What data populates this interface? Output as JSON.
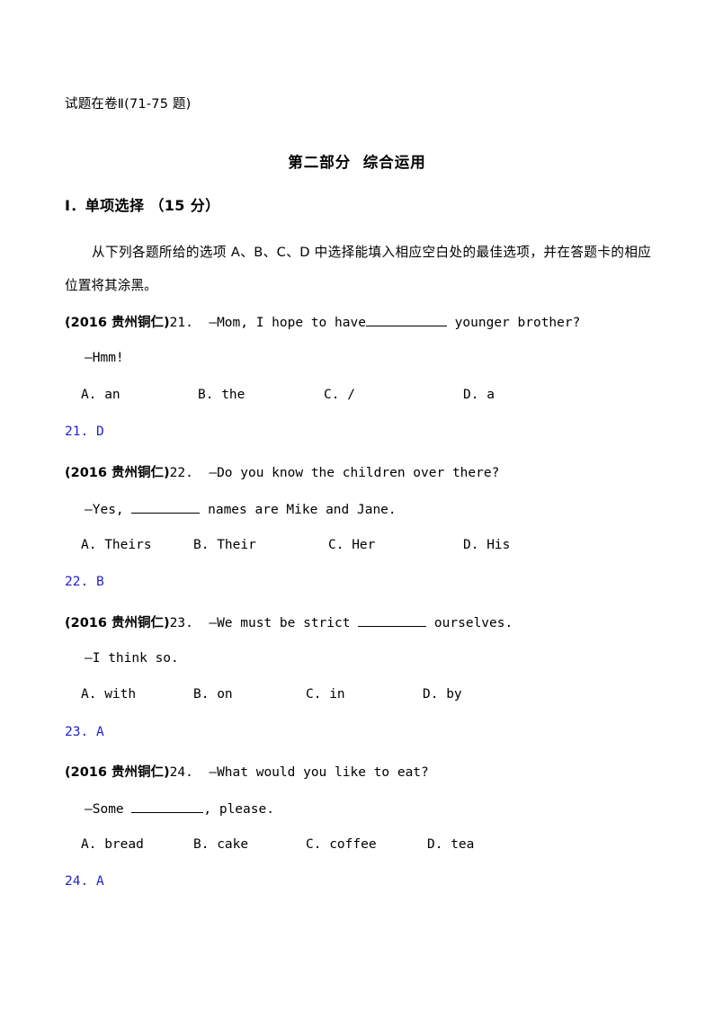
{
  "page": {
    "header_note": "试题在卷Ⅱ(71-75 题)",
    "part_title": "第二部分  综合运用",
    "section_heading": "Ⅰ．单项选择 （15 分）",
    "instructions": "从下列各题所给的选项 A、B、C、D 中选择能填入相应空白处的最佳选项，并在答题卡的相应位置将其涂黑。",
    "answer_color": "#2222cc",
    "text_color": "#000000",
    "background": "#ffffff"
  },
  "questions": [
    {
      "source": "(2016 贵州铜仁)",
      "number": "21.",
      "stem_before": "  —Mom, I hope to have",
      "stem_after": " younger brother?",
      "reply": "—Hmm!",
      "options": [
        {
          "letter": "A.",
          "text": "an"
        },
        {
          "letter": "B.",
          "text": "the"
        },
        {
          "letter": "C.",
          "text": "/"
        },
        {
          "letter": "D.",
          "text": "a"
        }
      ],
      "answer_label": "21.",
      "answer_value": "D"
    },
    {
      "source": "(2016 贵州铜仁)",
      "number": "22.",
      "stem_before": "  —Do you know the children over there?",
      "stem_after": "",
      "reply_before": "—Yes, ",
      "reply_after": " names are Mike and Jane.",
      "options": [
        {
          "letter": "A.",
          "text": "Theirs"
        },
        {
          "letter": "B.",
          "text": "Their"
        },
        {
          "letter": "C.",
          "text": "Her"
        },
        {
          "letter": "D.",
          "text": "His"
        }
      ],
      "answer_label": "22.",
      "answer_value": "B"
    },
    {
      "source": "(2016 贵州铜仁)",
      "number": "23.",
      "stem_before": "  —We must be strict ",
      "stem_after": " ourselves.",
      "reply": "—I think so.",
      "options": [
        {
          "letter": "A.",
          "text": "with"
        },
        {
          "letter": "B.",
          "text": "on"
        },
        {
          "letter": "C.",
          "text": "in"
        },
        {
          "letter": "D.",
          "text": "by"
        }
      ],
      "answer_label": "23.",
      "answer_value": "A"
    },
    {
      "source": "(2016 贵州铜仁)",
      "number": "24.",
      "stem_before": "  —What would you like to eat?",
      "stem_after": "",
      "reply_before": "—Some ",
      "reply_after": ", please.",
      "options": [
        {
          "letter": "A.",
          "text": "bread"
        },
        {
          "letter": "B.",
          "text": "cake"
        },
        {
          "letter": "C.",
          "text": "coffee"
        },
        {
          "letter": "D.",
          "text": "tea"
        }
      ],
      "answer_label": "24.",
      "answer_value": "A"
    }
  ]
}
